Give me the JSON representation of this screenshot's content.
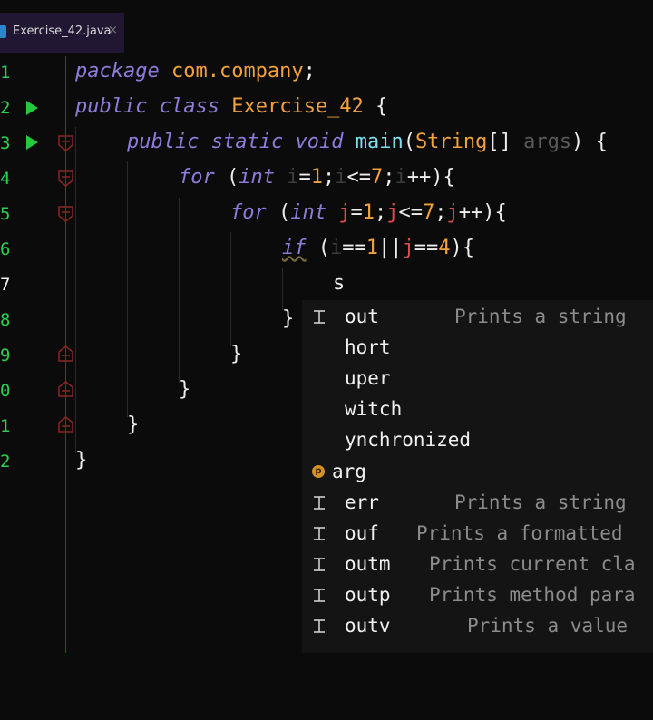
{
  "tab": {
    "filename": "Exercise_42.java",
    "close_glyph": "×"
  },
  "gutter": {
    "line_numbers": [
      "1",
      "2",
      "3",
      "4",
      "5",
      "6",
      "7",
      "8",
      "9",
      "0",
      "1",
      "2"
    ],
    "current_line_index": 6,
    "run_icons": "run-icon",
    "fold_icons": "fold-icon"
  },
  "code": {
    "l1": {
      "kw": "package",
      "pkg": "com.company",
      "semi": ";"
    },
    "l2": {
      "kw1": "public",
      "kw2": "class",
      "cls": "Exercise_42",
      "brace": "{"
    },
    "l3": {
      "kw1": "public",
      "kw2": "static",
      "kw3": "void",
      "fn": "main",
      "p1": "(",
      "type": "String",
      "arr": "[] ",
      "arg": "args",
      "p2": ") {"
    },
    "l4": {
      "kw": "for",
      "a": " (",
      "t": "int",
      "sp": " ",
      "v1": "i",
      "eq": "=",
      "n1": "1",
      "s1": ";",
      "v2": "i",
      "le": "<=",
      "n2": "7",
      "s2": ";",
      "v3": "i",
      "inc": "++){"
    },
    "l5": {
      "kw": "for",
      "a": " (",
      "t": "int",
      "sp": " ",
      "v1": "j",
      "eq": "=",
      "n1": "1",
      "s1": ";",
      "v2": "j",
      "le": "<=",
      "n2": "7",
      "s2": ";",
      "v3": "j",
      "inc": "++){"
    },
    "l6": {
      "kw": "if",
      "a": " (",
      "v1": "i",
      "eq1": "==",
      "n1": "1",
      "or": "||",
      "v2": "j",
      "eq2": "==",
      "n2": "4",
      "end": "){"
    },
    "l7": {
      "typed": "s"
    },
    "l8": {
      "brace": "}"
    },
    "l9": {
      "brace": "}"
    },
    "l10": {
      "brace": "}"
    },
    "l11": {
      "brace": "}"
    },
    "l12": {
      "brace": "}"
    }
  },
  "completion": {
    "items": [
      {
        "icon": "template-icon",
        "name": "out",
        "desc": "Prints a string"
      },
      {
        "icon": "",
        "name": "hort",
        "desc": ""
      },
      {
        "icon": "",
        "name": "uper",
        "desc": ""
      },
      {
        "icon": "",
        "name": "witch",
        "desc": ""
      },
      {
        "icon": "",
        "name": "ynchronized",
        "desc": ""
      },
      {
        "icon": "parameter-icon",
        "badge": "p",
        "name": "arg",
        "desc": ""
      },
      {
        "icon": "template-icon",
        "name": "err",
        "desc": "Prints a string"
      },
      {
        "icon": "template-icon",
        "name": "ouf",
        "desc": "Prints a formatted"
      },
      {
        "icon": "template-icon",
        "name": "outm",
        "desc": "Prints current cla"
      },
      {
        "icon": "template-icon",
        "name": "outp",
        "desc": "Prints method para"
      },
      {
        "icon": "template-icon",
        "name": "outv",
        "desc": "Prints a value"
      }
    ]
  },
  "colors": {
    "keyword": "#8f7bd9",
    "class": "#f2a23c",
    "method": "#7be0f0",
    "variable": "#e24b4b",
    "number": "#f2a23c",
    "line_number": "#27d14a"
  }
}
